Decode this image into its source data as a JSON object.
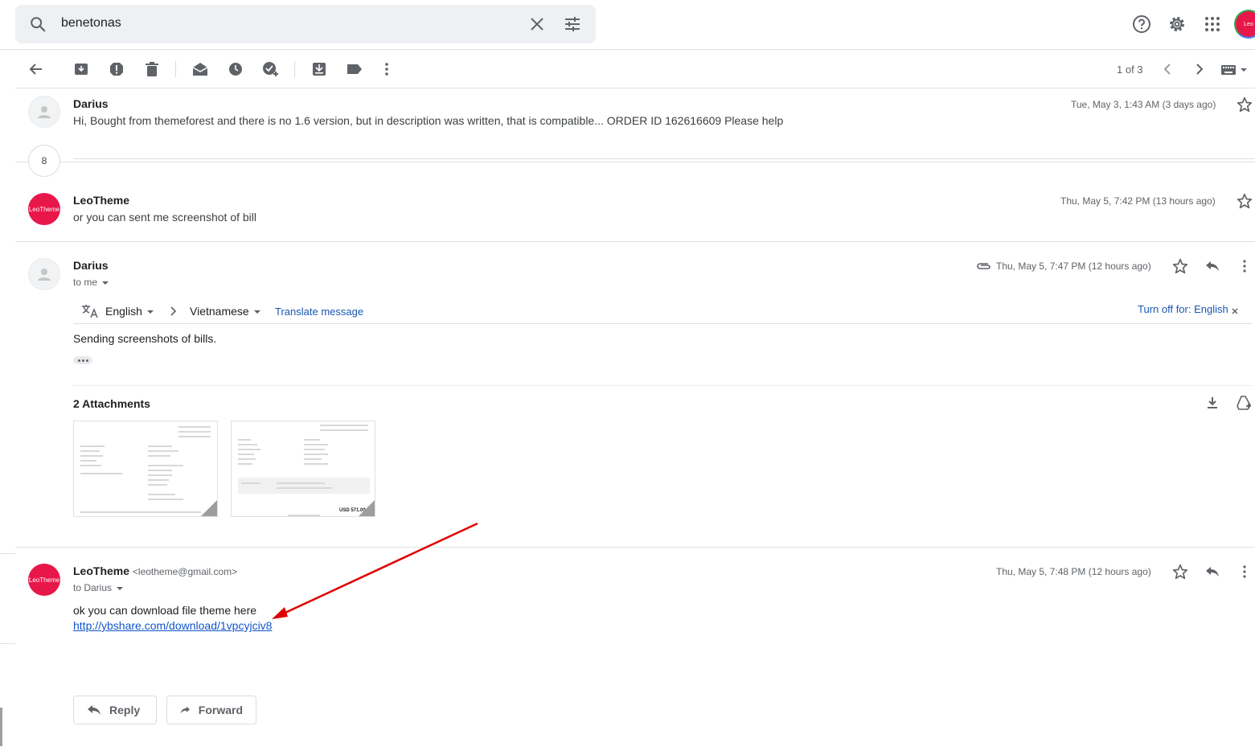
{
  "search": {
    "query": "benetonas"
  },
  "header": {
    "account_initials": "Leo"
  },
  "toolbar": {
    "pager": "1 of 3"
  },
  "messages": [
    {
      "sender": "Darius",
      "snippet": "Hi, Bought from themeforest and there is no 1.6 version, but in description was written, that is compatible... ORDER ID 162616609 Please help",
      "date": "Tue, May 3, 1:43 AM (3 days ago)"
    },
    {
      "sender": "LeoTheme",
      "snippet": "or you can sent me screenshot of bill",
      "date": "Thu, May 5, 7:42 PM (13 hours ago)",
      "avatar_text": "LeoTheme"
    },
    {
      "sender": "Darius",
      "to": "to me",
      "date": "Thu, May 5, 7:47 PM (12 hours ago)",
      "body": "Sending screenshots of bills.",
      "attachments_title": "2 Attachments",
      "attachment_amount": "USD 571.00"
    },
    {
      "sender": "LeoTheme",
      "email": "<leotheme@gmail.com>",
      "to": "to Darius",
      "date": "Thu, May 5, 7:48 PM (12 hours ago)",
      "body": "ok you can download file theme here",
      "link": "http://ybshare.com/download/1vpcyjciv8",
      "avatar_text": "LeoTheme"
    }
  ],
  "collapsed_count": "8",
  "translate": {
    "from": "English",
    "to": "Vietnamese",
    "action": "Translate message",
    "turn_off": "Turn off for: English"
  },
  "actions": {
    "reply": "Reply",
    "forward": "Forward"
  },
  "colors": {
    "brand_red": "#e8174a",
    "link": "#1155cc",
    "arrow": "#e00000"
  }
}
